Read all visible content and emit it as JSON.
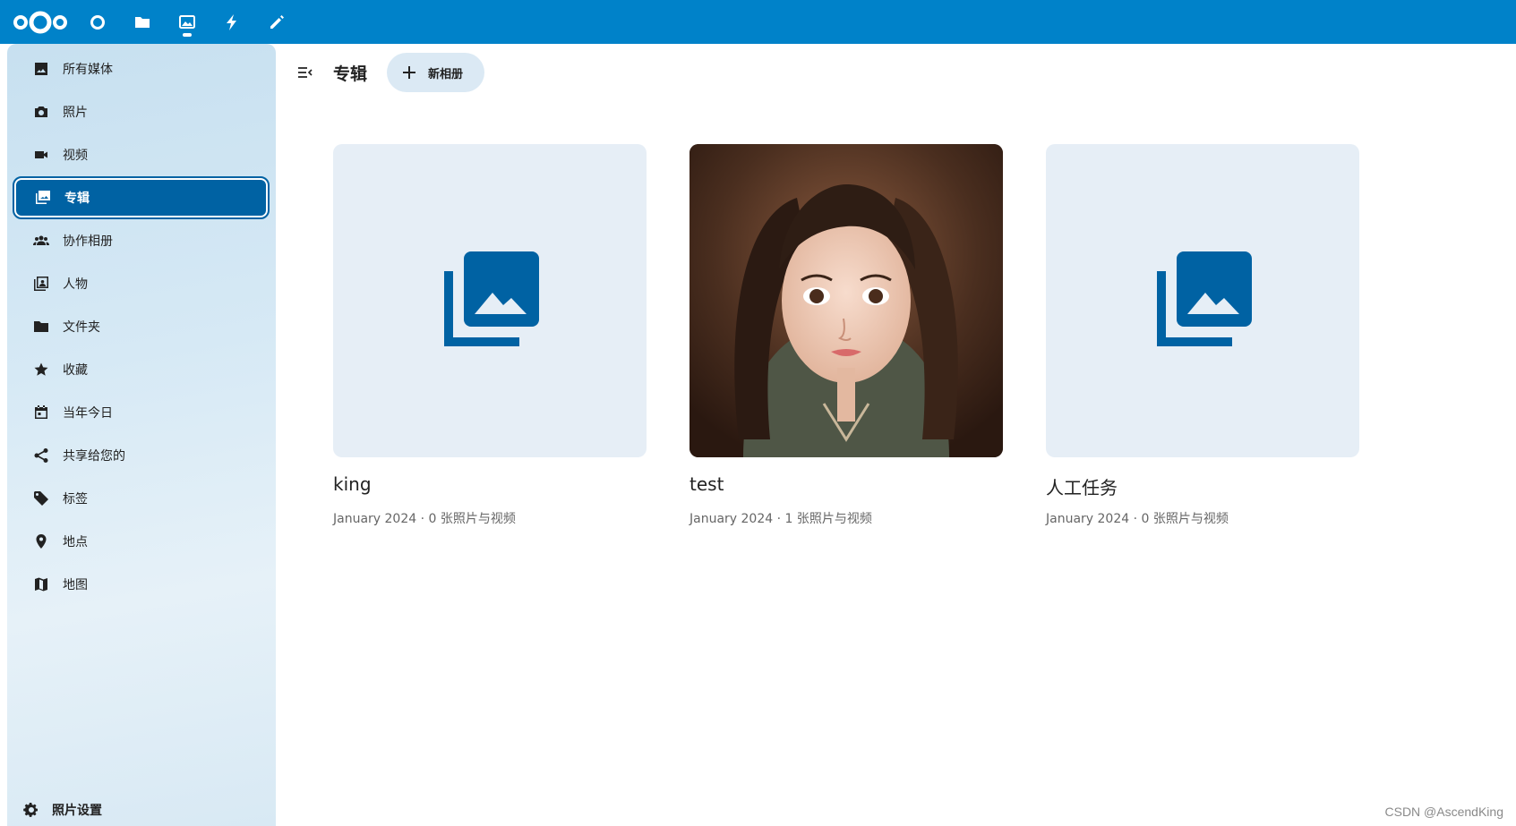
{
  "topbar": {
    "brand_color": "#0082c9",
    "apps": [
      {
        "name": "dashboard",
        "icon": "circle-icon"
      },
      {
        "name": "files",
        "icon": "folder-icon"
      },
      {
        "name": "photos",
        "icon": "image-icon",
        "active": true
      },
      {
        "name": "activity",
        "icon": "bolt-icon"
      },
      {
        "name": "notes",
        "icon": "pencil-icon"
      }
    ]
  },
  "sidebar": {
    "items": [
      {
        "label": "所有媒体",
        "icon": "image-icon"
      },
      {
        "label": "照片",
        "icon": "camera-icon"
      },
      {
        "label": "视频",
        "icon": "video-icon"
      },
      {
        "label": "专辑",
        "icon": "album-icon",
        "active": true
      },
      {
        "label": "协作相册",
        "icon": "people-icon"
      },
      {
        "label": "人物",
        "icon": "person-book-icon"
      },
      {
        "label": "文件夹",
        "icon": "folder-icon"
      },
      {
        "label": "收藏",
        "icon": "star-icon"
      },
      {
        "label": "当年今日",
        "icon": "calendar-icon"
      },
      {
        "label": "共享给您的",
        "icon": "share-icon"
      },
      {
        "label": "标签",
        "icon": "tag-icon"
      },
      {
        "label": "地点",
        "icon": "map-pin-icon"
      },
      {
        "label": "地图",
        "icon": "map-icon"
      }
    ],
    "settings_label": "照片设置"
  },
  "header": {
    "title": "专辑",
    "new_album_label": "新相册"
  },
  "albums": [
    {
      "name": "king",
      "meta": "January 2024 · 0 张照片与视频",
      "has_cover": false
    },
    {
      "name": "test",
      "meta": "January 2024 · 1 张照片与视频",
      "has_cover": true
    },
    {
      "name": "人工任务",
      "meta": "January 2024 · 0 张照片与视频",
      "has_cover": false
    }
  ],
  "colors": {
    "accent": "#0062a3",
    "placeholder_bg": "#e6eef6"
  },
  "watermark": "CSDN @AscendKing"
}
